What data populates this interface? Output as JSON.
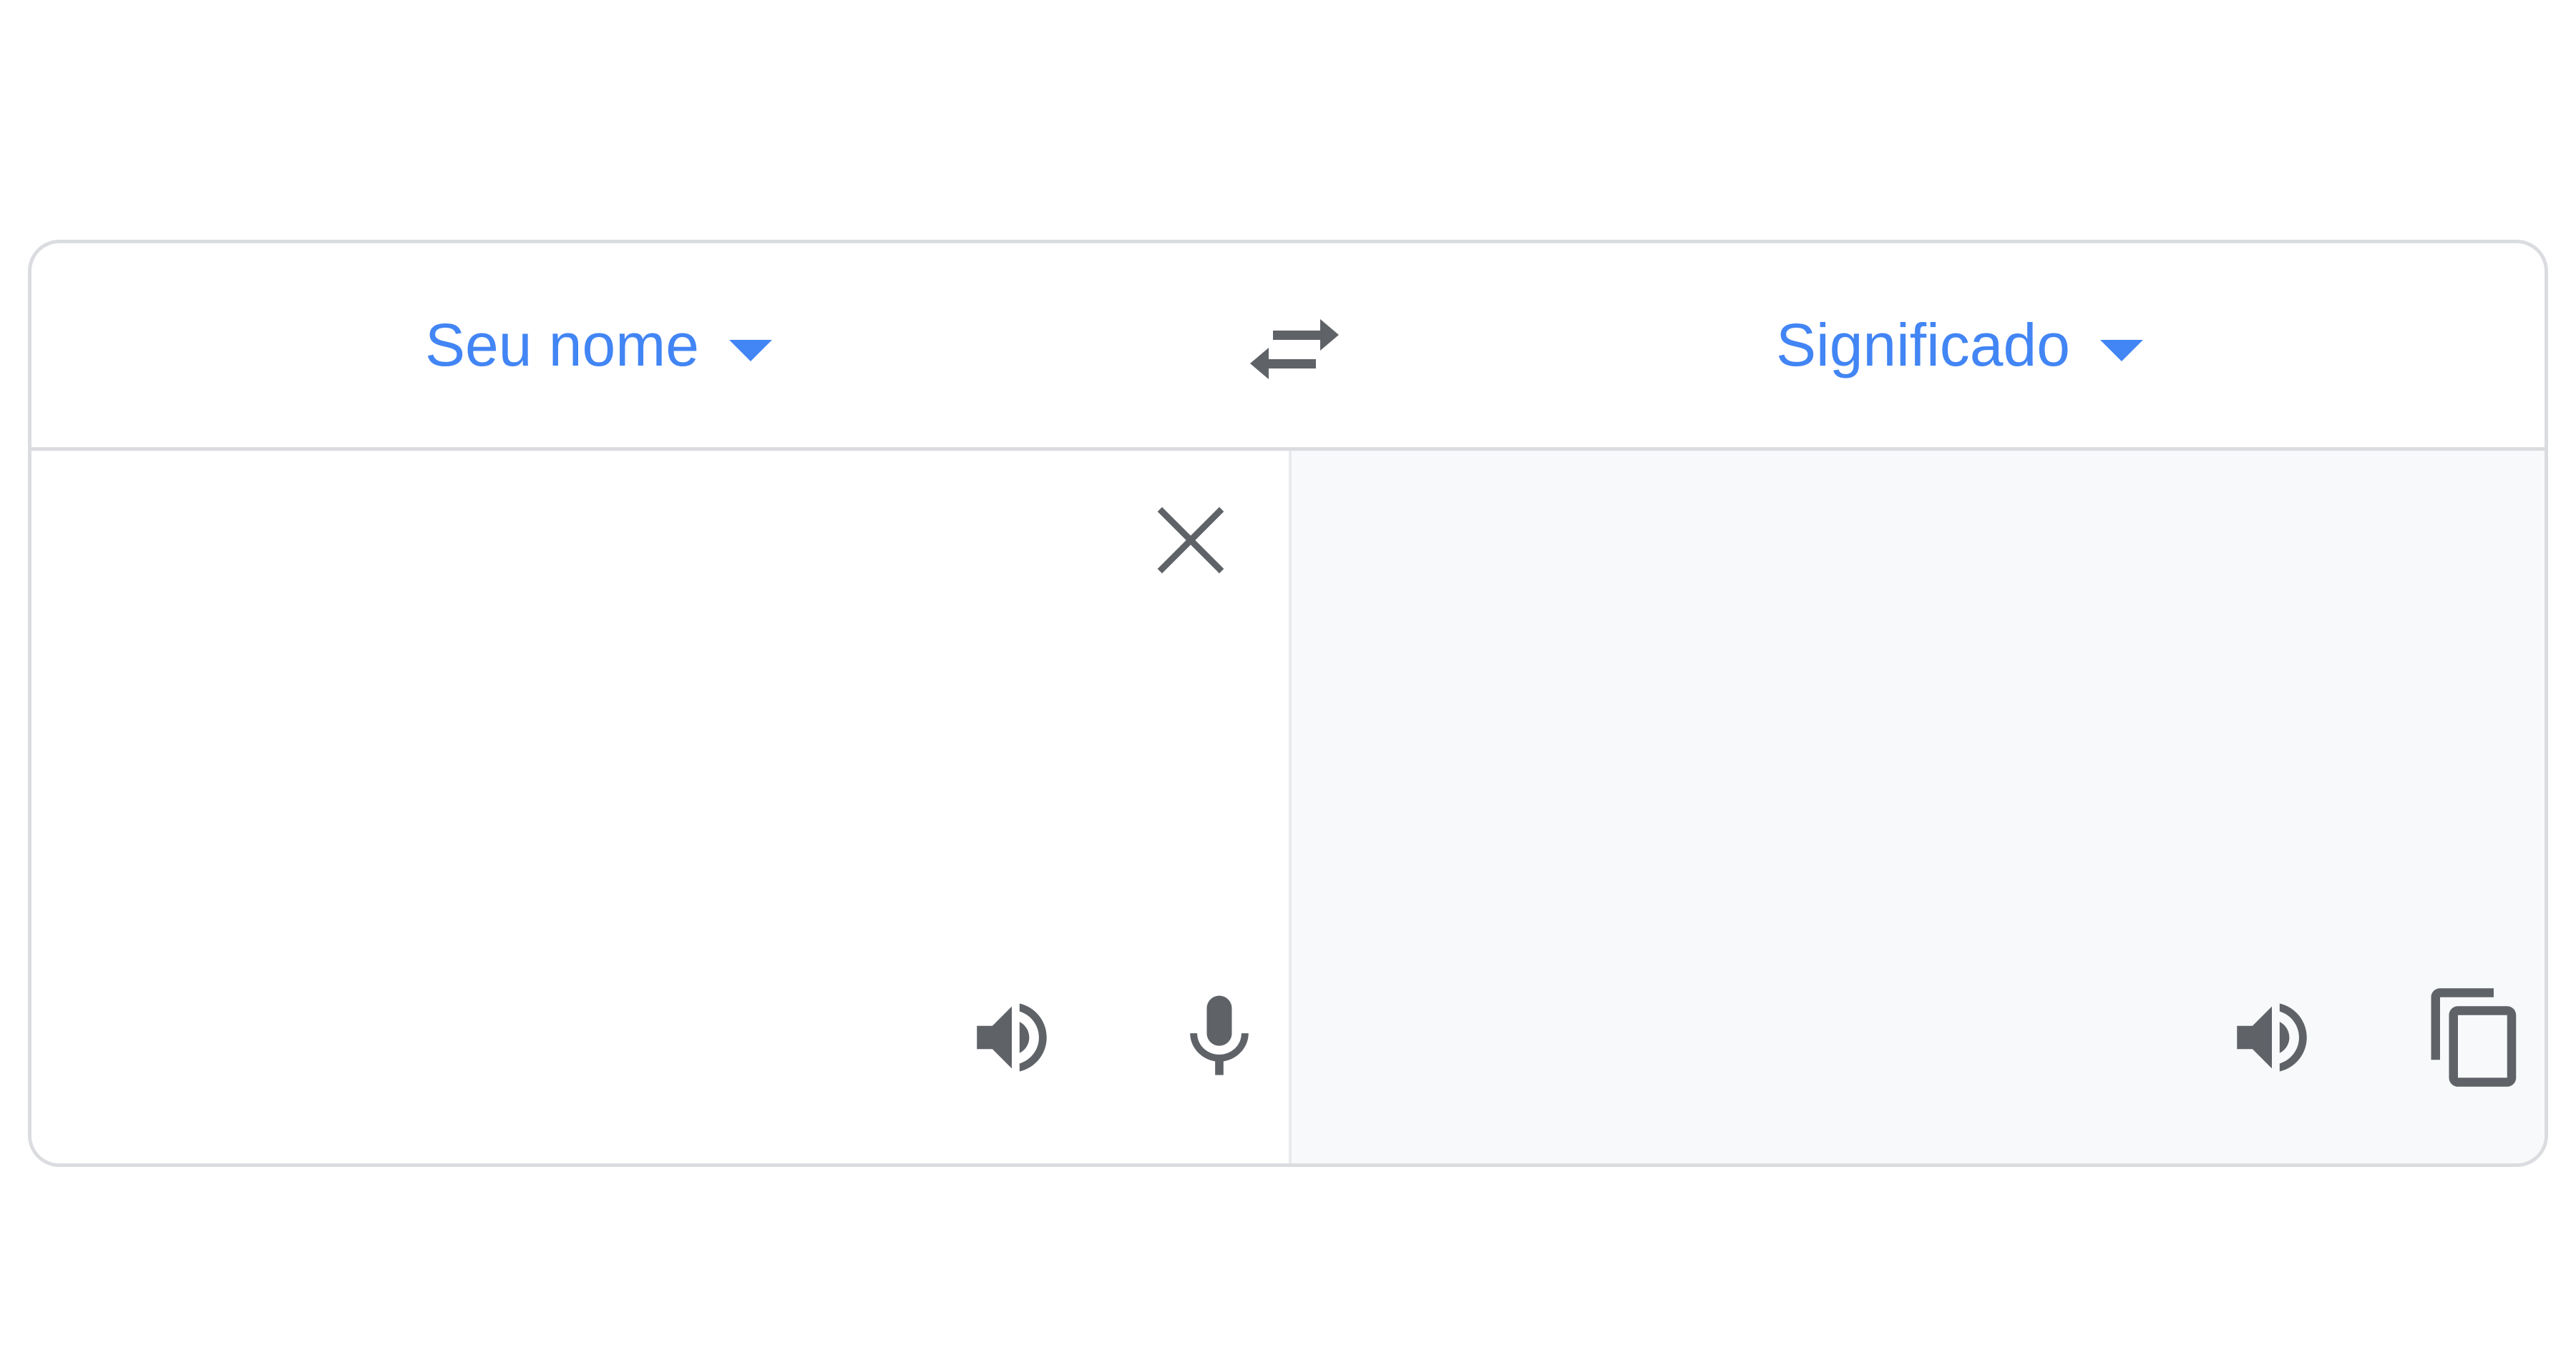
{
  "header": {
    "source_language": "Seu nome",
    "target_language": "Significado"
  },
  "source": {
    "value": "",
    "placeholder": ""
  },
  "icons": {
    "swap": "swap-languages-icon",
    "clear": "close-icon",
    "speak": "volume-up-icon",
    "mic": "microphone-icon",
    "copy": "copy-icon",
    "dropdown": "caret-down-icon"
  },
  "colors": {
    "accent": "#4285f4",
    "icon": "#5f6368",
    "border": "#dadce0",
    "output_background": "#f8f9fa"
  }
}
